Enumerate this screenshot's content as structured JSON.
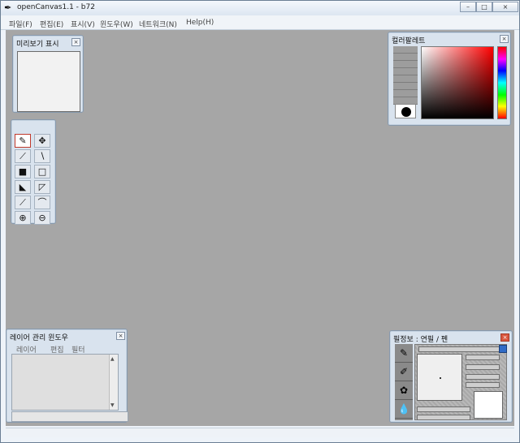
{
  "window": {
    "title": "openCanvas1.1 - b72",
    "app_icon": "pen-icon",
    "minimize": "–",
    "maximize": "□",
    "close": "×"
  },
  "menu": {
    "items": [
      "파일(F)",
      "편집(E)",
      "표시(V)",
      "윈도우(W)",
      "네트워크(N)",
      "Help(H)"
    ]
  },
  "panels": {
    "preview": {
      "title": "미리보기 표시",
      "close": "×"
    },
    "tools": {
      "items": [
        "pen",
        "move",
        "dropper",
        "line",
        "fill",
        "select",
        "polygon-fill",
        "polygon-select",
        "polyline",
        "curve",
        "zoom-in",
        "zoom-out"
      ]
    },
    "palette": {
      "title": "컬러팔레트",
      "close": "×"
    },
    "layers": {
      "title": "레이어 관리 윈도우",
      "close": "×",
      "tabs": [
        "레이어",
        "편집",
        "필터"
      ]
    },
    "brush": {
      "title": "필정보 : 연필 / 펜",
      "close": "×"
    }
  },
  "colors": {
    "workspace": "#a6a6a6",
    "panel": "#d9e3ee",
    "hue_start": "#ff0000"
  }
}
